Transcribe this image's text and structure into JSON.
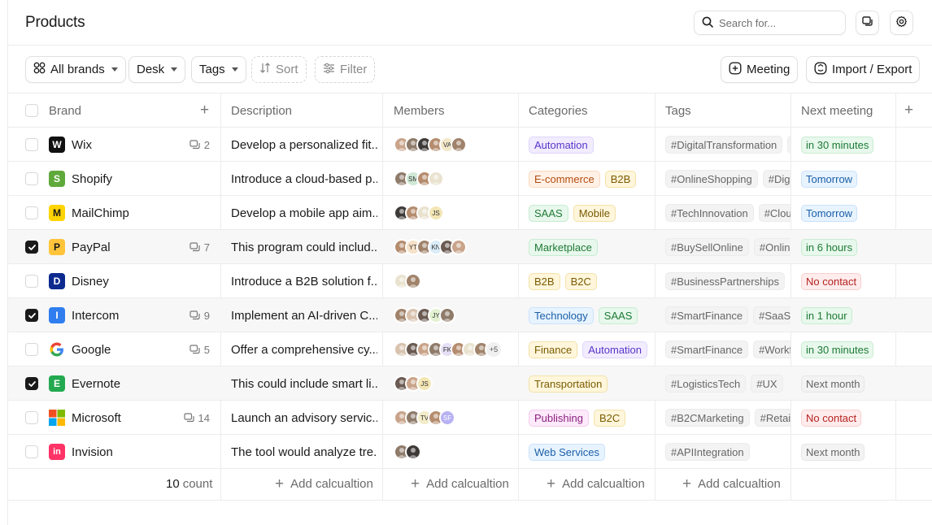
{
  "header": {
    "title": "Products"
  },
  "search": {
    "placeholder": "Search for..."
  },
  "toolbar": {
    "all_brands": "All brands",
    "desk": "Desk",
    "tags": "Tags",
    "sort": "Sort",
    "filter": "Filter",
    "meeting": "Meeting",
    "import_export": "Import / Export"
  },
  "columns": {
    "brand": "Brand",
    "description": "Description",
    "members": "Members",
    "categories": "Categories",
    "tags": "Tags",
    "next_meeting": "Next meeting"
  },
  "rows": [
    {
      "brand": "Wix",
      "comments": "2",
      "checked": false,
      "desc": "Develop a personalized fit...",
      "members": [
        "",
        "",
        "",
        "",
        "VA",
        ""
      ],
      "more": "",
      "categories": [
        {
          "label": "Automation",
          "style": "purple"
        }
      ],
      "tags": [
        "#DigitalTransformation",
        "#A"
      ],
      "meeting": {
        "label": "in 30 minutes",
        "style": "green"
      }
    },
    {
      "brand": "Shopify",
      "comments": "",
      "checked": false,
      "desc": "Introduce a cloud-based p...",
      "members": [
        "",
        "SM",
        "",
        ""
      ],
      "more": "",
      "categories": [
        {
          "label": "E-commerce",
          "style": "orange"
        },
        {
          "label": "B2B",
          "style": "yellow"
        }
      ],
      "tags": [
        "#OnlineShopping",
        "#Digita"
      ],
      "meeting": {
        "label": "Tomorrow",
        "style": "blue"
      }
    },
    {
      "brand": "MailChimp",
      "comments": "",
      "checked": false,
      "desc": "Develop a mobile app aim...",
      "members": [
        "",
        "",
        "",
        "JS"
      ],
      "more": "",
      "categories": [
        {
          "label": "SAAS",
          "style": "green"
        },
        {
          "label": "Mobile",
          "style": "yellow"
        }
      ],
      "tags": [
        "#TechInnovation",
        "#Cloud"
      ],
      "meeting": {
        "label": "Tomorrow",
        "style": "blue"
      }
    },
    {
      "brand": "PayPal",
      "comments": "7",
      "checked": true,
      "desc": "This program could includ...",
      "members": [
        "",
        "YT",
        "",
        "KN",
        "",
        ""
      ],
      "more": "",
      "categories": [
        {
          "label": "Marketplace",
          "style": "green"
        }
      ],
      "tags": [
        "#BuySellOnline",
        "#OnlineM"
      ],
      "meeting": {
        "label": "in 6 hours",
        "style": "green"
      }
    },
    {
      "brand": "Disney",
      "comments": "",
      "checked": false,
      "desc": "Introduce a B2B solution f...",
      "members": [
        "",
        ""
      ],
      "more": "",
      "categories": [
        {
          "label": "B2B",
          "style": "yellow"
        },
        {
          "label": "B2C",
          "style": "yellow"
        }
      ],
      "tags": [
        "#BusinessPartnerships"
      ],
      "meeting": {
        "label": "No contact",
        "style": "red"
      }
    },
    {
      "brand": "Intercom",
      "comments": "9",
      "checked": true,
      "desc": "Implement an AI-driven C...",
      "members": [
        "",
        "",
        "",
        "JY",
        ""
      ],
      "more": "",
      "categories": [
        {
          "label": "Technology",
          "style": "blue"
        },
        {
          "label": "SAAS",
          "style": "green"
        }
      ],
      "tags": [
        "#SmartFinance",
        "#SaaSPl"
      ],
      "meeting": {
        "label": "in 1 hour",
        "style": "green"
      }
    },
    {
      "brand": "Google",
      "comments": "5",
      "checked": false,
      "desc": "Offer a comprehensive cy...",
      "members": [
        "",
        "",
        "",
        "",
        "FK",
        "",
        "",
        ""
      ],
      "more": "+5",
      "categories": [
        {
          "label": "Finance",
          "style": "yellow"
        },
        {
          "label": "Automation",
          "style": "purple"
        }
      ],
      "tags": [
        "#SmartFinance",
        "#Workflo"
      ],
      "meeting": {
        "label": "in 30 minutes",
        "style": "green"
      }
    },
    {
      "brand": "Evernote",
      "comments": "",
      "checked": true,
      "desc": "This could include smart li...",
      "members": [
        "",
        "",
        "JS"
      ],
      "more": "",
      "categories": [
        {
          "label": "Transportation",
          "style": "yellow"
        }
      ],
      "tags": [
        "#LogisticsTech",
        "#UX"
      ],
      "meeting": {
        "label": "Next month",
        "style": "gray"
      }
    },
    {
      "brand": "Microsoft",
      "comments": "14",
      "checked": false,
      "desc": "Launch an advisory servic...",
      "members": [
        "",
        "",
        "TV",
        "",
        "SF"
      ],
      "more": "",
      "categories": [
        {
          "label": "Publishing",
          "style": "pink"
        },
        {
          "label": "B2C",
          "style": "yellow"
        }
      ],
      "tags": [
        "#B2CMarketing",
        "#RetailT"
      ],
      "meeting": {
        "label": "No contact",
        "style": "red"
      }
    },
    {
      "brand": "Invision",
      "comments": "",
      "checked": false,
      "desc": "The tool would analyze tre...",
      "members": [
        "",
        ""
      ],
      "more": "",
      "categories": [
        {
          "label": "Web Services",
          "style": "blue"
        }
      ],
      "tags": [
        "#APIIntegration"
      ],
      "meeting": {
        "label": "Next month",
        "style": "gray"
      }
    }
  ],
  "footer": {
    "count_number": "10",
    "count_label": "count",
    "add_calc": "Add calcualtion"
  },
  "colors": {
    "purple_bg": "#f1ecff",
    "purple_fg": "#5b34c9",
    "purple_bd": "#dfd5fb",
    "orange_bg": "#fff1e6",
    "orange_fg": "#b44d10",
    "orange_bd": "#fbd9c0",
    "yellow_bg": "#fff6dc",
    "yellow_fg": "#7a5b00",
    "yellow_bd": "#f3e2a8",
    "green_bg": "#e8f8ec",
    "green_fg": "#1d7a36",
    "green_bd": "#c8ecd2",
    "blue_bg": "#e7f3ff",
    "blue_fg": "#1b5fa8",
    "blue_bd": "#cbe2fa",
    "red_bg": "#ffecec",
    "red_fg": "#b4231f",
    "red_bd": "#f8cfcf",
    "pink_bg": "#fdeafb",
    "pink_fg": "#8c1f7e",
    "pink_bd": "#f4cdee",
    "gray_bg": "#f3f3f3",
    "gray_fg": "#666666",
    "gray_bd": "#e6e6e6"
  },
  "logos": [
    {
      "icon": "wix-logo-icon",
      "bg": "#111111",
      "glyph": "W"
    },
    {
      "icon": "shopify-logo-icon",
      "bg": "#5fa93a",
      "glyph": "S"
    },
    {
      "icon": "mailchimp-logo-icon",
      "bg": "#ffd400",
      "glyph": "M"
    },
    {
      "icon": "paypal-logo-icon",
      "bg": "#ffc43a",
      "glyph": "P"
    },
    {
      "icon": "disney-logo-icon",
      "bg": "#0d2a8f",
      "glyph": "D"
    },
    {
      "icon": "intercom-logo-icon",
      "bg": "#2f7ef0",
      "glyph": "I"
    },
    {
      "icon": "google-logo-icon",
      "bg": "#ffffff",
      "glyph": "G"
    },
    {
      "icon": "evernote-logo-icon",
      "bg": "#23a94f",
      "glyph": "E"
    },
    {
      "icon": "microsoft-logo-icon",
      "bg": "#ffffff",
      "glyph": ""
    },
    {
      "icon": "invision-logo-icon",
      "bg": "#ff3366",
      "glyph": "in"
    }
  ]
}
